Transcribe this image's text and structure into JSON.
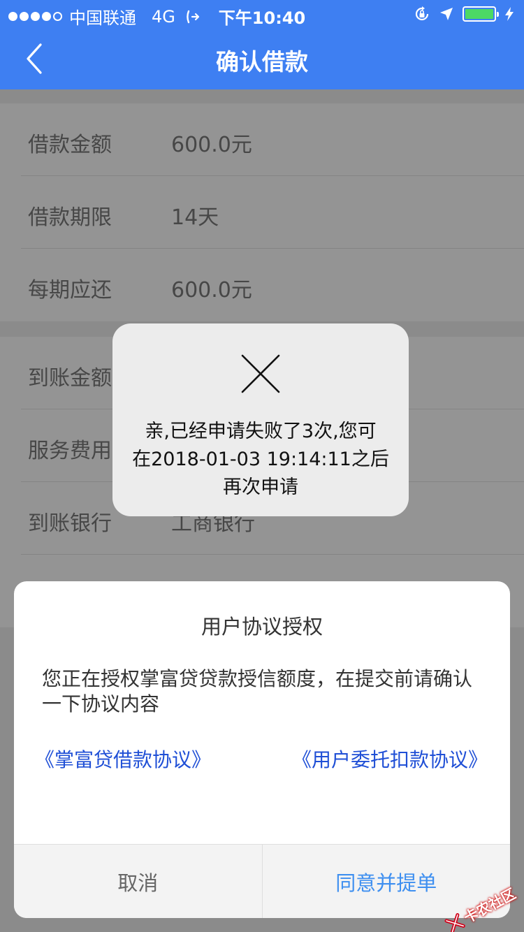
{
  "status_bar": {
    "carrier": "中国联通",
    "network": "4G",
    "time": "下午10:40",
    "icons": [
      "signal-dots-icon",
      "call-forward-icon",
      "orientation-lock-icon",
      "location-arrow-icon",
      "battery-icon",
      "charging-bolt-icon"
    ],
    "battery_level": 1.0,
    "battery_color": "#4cd964"
  },
  "nav": {
    "title": "确认借款",
    "back_icon": "chevron-left-icon",
    "color": "#3e7ff2"
  },
  "loan_info": {
    "rows": [
      {
        "label": "借款金额",
        "value": "600.0元"
      },
      {
        "label": "借款期限",
        "value": "14天"
      },
      {
        "label": "每期应还",
        "value": "600.0元"
      }
    ]
  },
  "account_info": {
    "rows": [
      {
        "label": "到账金额",
        "value": ""
      },
      {
        "label": "服务费用",
        "value": ""
      },
      {
        "label": "到账银行",
        "value": "工商银行"
      }
    ]
  },
  "toast": {
    "icon": "close-x-icon",
    "line1": "亲,已经申请失败了3次,您可",
    "line2": "在2018-01-03 19:14:11之后",
    "line3": "再次申请"
  },
  "dialog": {
    "title": "用户协议授权",
    "body": "您正在授权掌富贷贷款授信额度，在提交前请确认一下协议内容",
    "link_loan": "《掌富贷借款协议》",
    "link_debit": "《用户委托扣款协议》",
    "cancel_label": "取消",
    "confirm_label": "同意并提单",
    "confirm_color": "#3e8ff0",
    "link_color": "#1f4fd6"
  },
  "watermark": {
    "text": "卡农社区",
    "icon": "kanong-logo-icon"
  }
}
